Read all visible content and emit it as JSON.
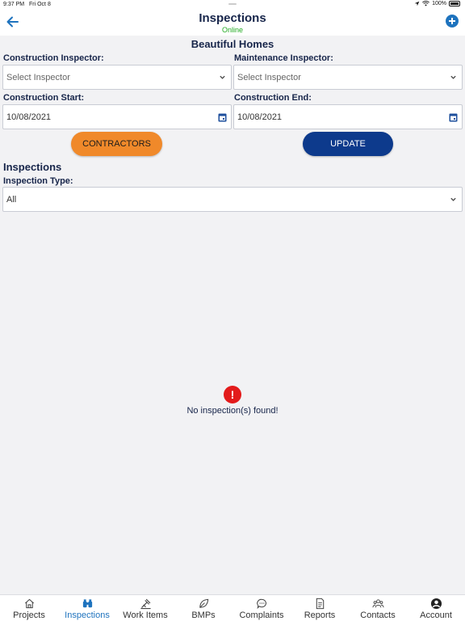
{
  "status_bar": {
    "time": "9:37 PM",
    "date": "Fri Oct 8",
    "battery": "100%"
  },
  "header": {
    "title": "Inspections",
    "connection_status": "Online"
  },
  "project_name": "Beautiful Homes",
  "form": {
    "construction_inspector": {
      "label": "Construction Inspector:",
      "placeholder": "Select Inspector"
    },
    "maintenance_inspector": {
      "label": "Maintenance Inspector:",
      "placeholder": "Select Inspector"
    },
    "construction_start": {
      "label": "Construction Start:",
      "value": "10/08/2021"
    },
    "construction_end": {
      "label": "Construction End:",
      "value": "10/08/2021"
    }
  },
  "buttons": {
    "contractors": "CONTRACTORS",
    "update": "UPDATE"
  },
  "inspections": {
    "heading": "Inspections",
    "type_label": "Inspection Type:",
    "type_value": "All",
    "empty_message": "No inspection(s) found!"
  },
  "tabs": [
    {
      "label": "Projects",
      "icon": "home-icon"
    },
    {
      "label": "Inspections",
      "icon": "binoculars-icon",
      "active": true
    },
    {
      "label": "Work Items",
      "icon": "tools-icon"
    },
    {
      "label": "BMPs",
      "icon": "leaf-icon"
    },
    {
      "label": "Complaints",
      "icon": "chat-bubble-icon"
    },
    {
      "label": "Reports",
      "icon": "document-icon"
    },
    {
      "label": "Contacts",
      "icon": "group-icon"
    },
    {
      "label": "Account",
      "icon": "user-circle-icon"
    }
  ],
  "colors": {
    "accent_blue": "#1e73be",
    "online_green": "#22aa22",
    "contractors_orange": "#f0892a",
    "update_navy": "#0d3a8c",
    "alert_red": "#e31b1b",
    "text_navy": "#17254a"
  }
}
